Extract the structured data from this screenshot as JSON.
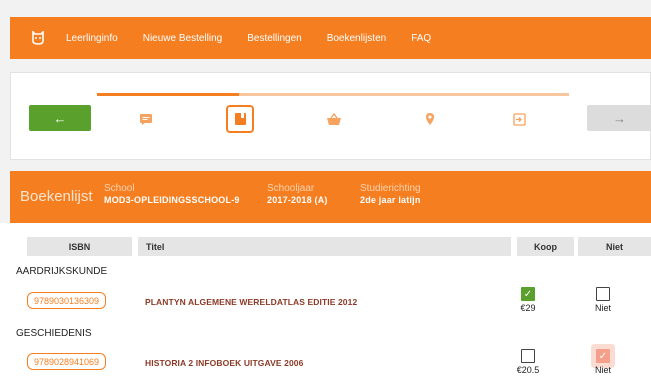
{
  "nav": {
    "items": [
      "Leerlinginfo",
      "Nieuwe Bestelling",
      "Bestellingen",
      "Boekenlijsten",
      "FAQ"
    ]
  },
  "stepper": {
    "progress": 0.3,
    "back_label": "←",
    "next_label": "→"
  },
  "info": {
    "title": "Boekenlijst",
    "school_label": "School",
    "school_value": "MOD3-OPLEIDINGSSCHOOL-9",
    "year_label": "Schooljaar",
    "year_value": "2017-2018 (A)",
    "direction_label": "Studierichting",
    "direction_value": "2de jaar latijn"
  },
  "table": {
    "headers": {
      "isbn": "ISBN",
      "title": "Titel",
      "buy": "Koop",
      "not": "Niet"
    },
    "sections": [
      {
        "name": "AARDRIJKSKUNDE",
        "isbn": "9789030136309",
        "title": "PLANTYN ALGEMENE WERELDATLAS EDITIE 2012",
        "buy_checked": true,
        "price": "€29",
        "not_checked": false,
        "not_label": "Niet"
      },
      {
        "name": "GESCHIEDENIS",
        "isbn": "9789028941069",
        "title": "HISTORIA 2 INFOBOEK UITGAVE 2006",
        "buy_checked": false,
        "price": "€20.5",
        "not_checked": true,
        "not_label": "Niet"
      }
    ]
  },
  "colors": {
    "accent": "#f57e20",
    "success": "#5aa02c",
    "title_text": "#8b3a26"
  }
}
